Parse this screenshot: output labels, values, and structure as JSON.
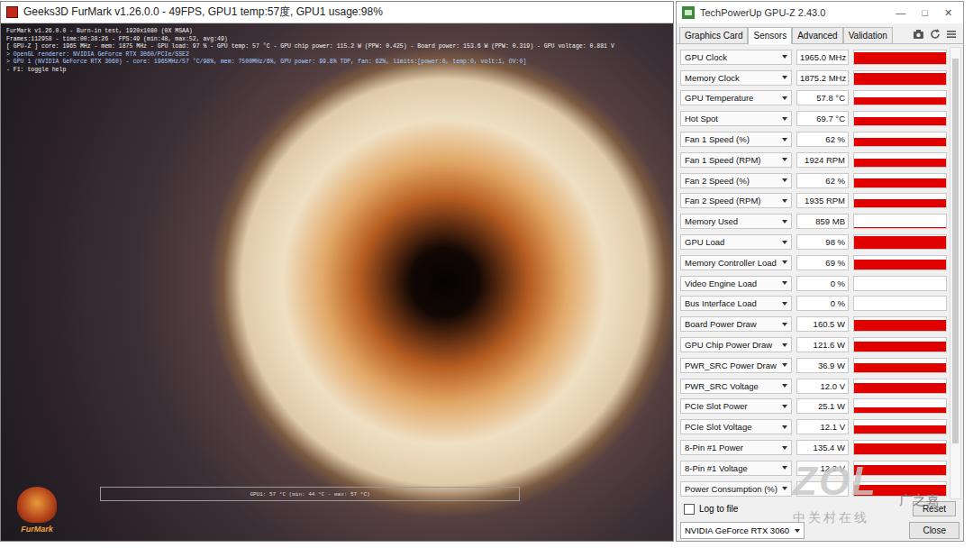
{
  "furmark": {
    "title": "Geeks3D FurMark v1.26.0.0 - 49FPS, GPU1 temp:57度, GPU1 usage:98%",
    "osd_lines": [
      {
        "text": "FurMark v1.26.0.0 - Burn-in test, 1920x1080 (0X MSAA)",
        "color": "#f2f2f2"
      },
      {
        "text": "Frames:112958 - time:00:38:26 - FPS:49 (min:48, max:52, avg:49)",
        "color": "#f2f2f2"
      },
      {
        "text": "[ GPU-Z ] core: 1965 MHz - mem: 1875 MHz - GPU load: 97 % - GPU temp: 57 °C - GPU chip power: 115.2 W (PPW: 0.425) - Board power: 153.6 W (PPW: 0.319) - GPU voltage: 0.881 V",
        "color": "#f2f2f2"
      },
      {
        "text": "> OpenGL renderer: NVIDIA GeForce RTX 3060/PCIe/SSE2",
        "color": "#a8d0ff"
      },
      {
        "text": "> GPU 1 (NVIDIA GeForce RTX 3060) - core: 1965MHz/57 °C/98%, mem: 7500MHz/6%, GPU power: 99.8% TDP, fan: 62%, limits:[power:0, temp:0, volt:1, OV:0]",
        "color": "#a8d0ff"
      },
      {
        "text": "- F1: toggle help",
        "color": "#f2f2f2"
      }
    ],
    "graph_label": "GPU1: 57 °C (min: 44 °C - max: 57 °C)",
    "logo_text": "FurMark"
  },
  "gpuz": {
    "title": "TechPowerUp GPU-Z 2.43.0",
    "controls": [
      "—",
      "□",
      "✕"
    ],
    "tabs": [
      {
        "label": "Graphics Card",
        "selected": false
      },
      {
        "label": "Sensors",
        "selected": true
      },
      {
        "label": "Advanced",
        "selected": false
      },
      {
        "label": "Validation",
        "selected": false
      }
    ],
    "sensors": [
      {
        "label": "GPU Clock",
        "value": "1965.0 MHz",
        "level": 0.88
      },
      {
        "label": "Memory Clock",
        "value": "1875.2 MHz",
        "level": 0.88
      },
      {
        "label": "GPU Temperature",
        "value": "57.8 °C",
        "level": 0.55
      },
      {
        "label": "Hot Spot",
        "value": "69.7 °C",
        "level": 0.6
      },
      {
        "label": "Fan 1 Speed (%)",
        "value": "62 %",
        "level": 0.62
      },
      {
        "label": "Fan 1 Speed (RPM)",
        "value": "1924 RPM",
        "level": 0.62
      },
      {
        "label": "Fan 2 Speed (%)",
        "value": "62 %",
        "level": 0.62
      },
      {
        "label": "Fan 2 Speed (RPM)",
        "value": "1935 RPM",
        "level": 0.62
      },
      {
        "label": "Memory Used",
        "value": "859 MB",
        "level": 0.1
      },
      {
        "label": "GPU Load",
        "value": "98 %",
        "level": 0.92
      },
      {
        "label": "Memory Controller Load",
        "value": "69 %",
        "level": 0.7
      },
      {
        "label": "Video Engine Load",
        "value": "0 %",
        "level": 0
      },
      {
        "label": "Bus Interface Load",
        "value": "0 %",
        "level": 0
      },
      {
        "label": "Board Power Draw",
        "value": "160.5 W",
        "level": 0.8
      },
      {
        "label": "GPU Chip Power Draw",
        "value": "121.6 W",
        "level": 0.75
      },
      {
        "label": "PWR_SRC Power Draw",
        "value": "36.9 W",
        "level": 0.65
      },
      {
        "label": "PWR_SRC Voltage",
        "value": "12.0 V",
        "level": 0.7
      },
      {
        "label": "PCIe Slot Power",
        "value": "25.1 W",
        "level": 0.4
      },
      {
        "label": "PCIe Slot Voltage",
        "value": "12.1 V",
        "level": 0.6
      },
      {
        "label": "8-Pin #1 Power",
        "value": "135.4 W",
        "level": 0.82
      },
      {
        "label": "8-Pin #1 Voltage",
        "value": "12.2 V",
        "level": 0.75
      },
      {
        "label": "Power Consumption (%)",
        "value": "",
        "level": 0.75
      }
    ],
    "scrollbar": {
      "level": 0.93
    },
    "log_to_file": {
      "label": "Log to file",
      "checked": false
    },
    "reset_button": "Reset",
    "gpu_select": "NVIDIA GeForce RTX 3060",
    "close_button": "Close"
  },
  "watermark": {
    "logo": "ZOL",
    "sub": "中关村在线",
    "author": "广之嘉"
  }
}
